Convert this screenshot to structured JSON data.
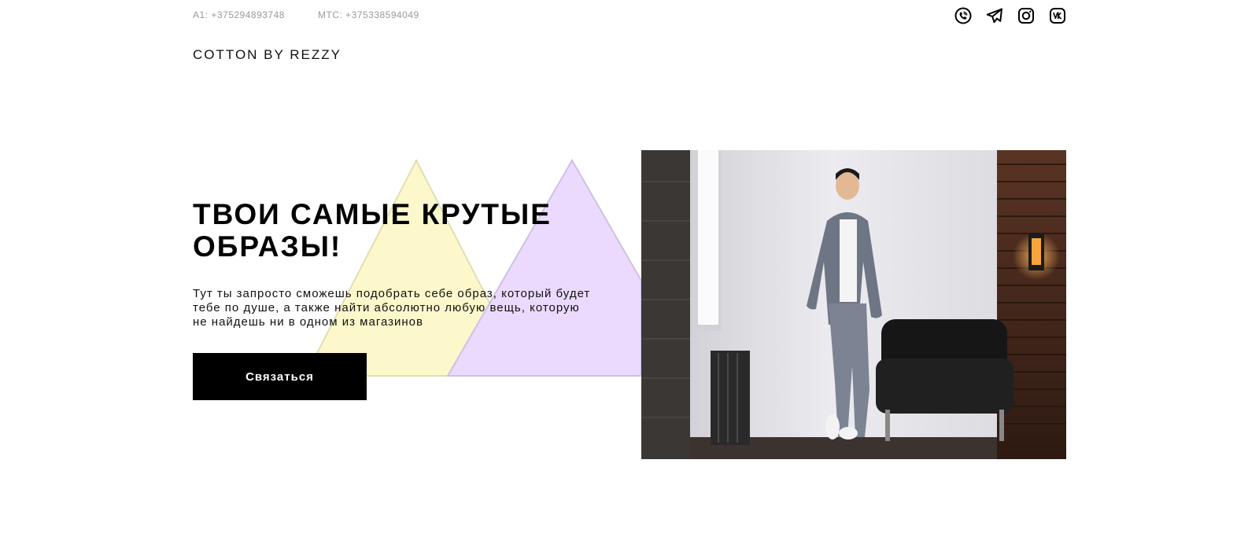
{
  "header": {
    "phones": [
      {
        "label": "A1: +375294893748"
      },
      {
        "label": "МТС: +375338594049"
      }
    ],
    "socials": [
      {
        "icon": "viber-icon"
      },
      {
        "icon": "telegram-icon"
      },
      {
        "icon": "instagram-icon"
      },
      {
        "icon": "vk-icon"
      }
    ],
    "logo": "COTTON BY REZZY"
  },
  "hero": {
    "title": "ТВОИ САМЫЕ КРУТЫЕ ОБРАЗЫ!",
    "text": "Тут ты запросто сможешь подобрать себе образ, который будет тебе по душе, а также найти абсолютно любую вещь, которую не найдешь ни в одном из магазинов",
    "button": "Связаться"
  },
  "colors": {
    "accent_yellow": "#fcf8cc",
    "accent_lilac": "#ebdafd",
    "button_bg": "#000000",
    "text_muted": "#9a9a9a"
  }
}
